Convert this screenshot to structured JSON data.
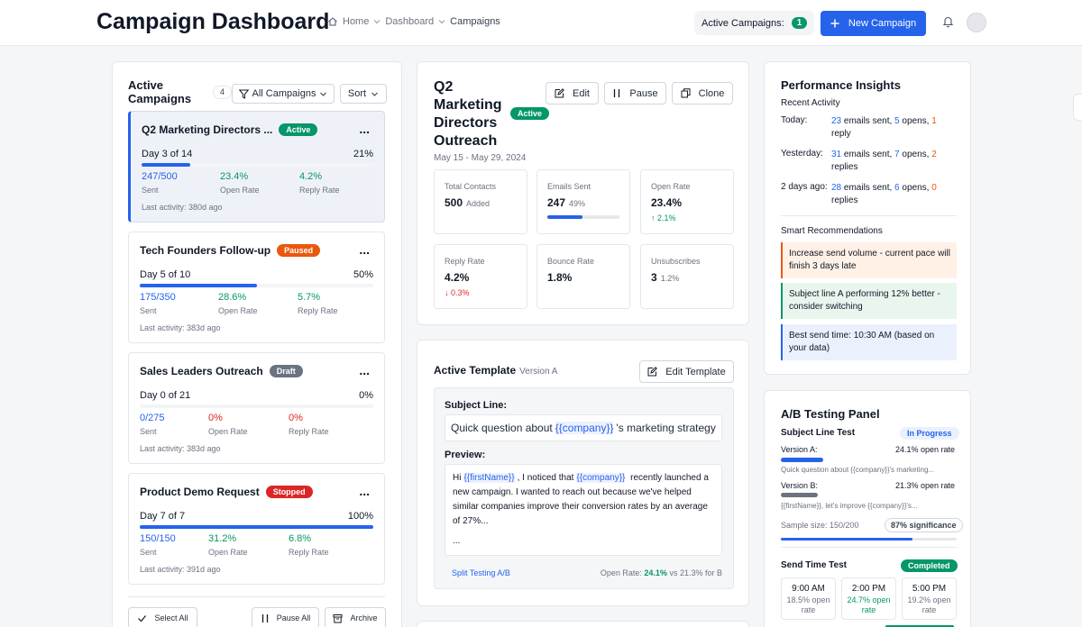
{
  "header": {
    "title": "Campaign Dashboard",
    "breadcrumb": [
      "Home",
      "Dashboard",
      "Campaigns"
    ],
    "active_campaigns_label": "Active Campaigns:",
    "active_campaigns_count": "1",
    "new_campaign_label": "New Campaign"
  },
  "left": {
    "title": "Active Campaigns",
    "count": "4",
    "filter_label": "All Campaigns",
    "sort_label": "Sort",
    "campaigns": [
      {
        "name": "Q2 Marketing Directors ...",
        "status": "Active",
        "day": "Day 3 of 14",
        "pct": "21%",
        "progress": 0.21,
        "sent": "247/500",
        "open": "23.4%",
        "reply": "4.2%",
        "sent_label": "Sent",
        "open_label": "Open Rate",
        "reply_label": "Reply Rate",
        "last": "Last activity: 380d ago",
        "more": "..."
      },
      {
        "name": "Tech Founders Follow-up",
        "status": "Paused",
        "day": "Day 5 of 10",
        "pct": "50%",
        "progress": 0.5,
        "sent": "175/350",
        "open": "28.6%",
        "reply": "5.7%",
        "sent_label": "Sent",
        "open_label": "Open Rate",
        "reply_label": "Reply Rate",
        "last": "Last activity: 383d ago",
        "more": "..."
      },
      {
        "name": "Sales Leaders Outreach",
        "status": "Draft",
        "day": "Day 0 of 21",
        "pct": "0%",
        "progress": 0,
        "sent": "0/275",
        "open": "0%",
        "reply": "0%",
        "sent_label": "Sent",
        "open_label": "Open Rate",
        "reply_label": "Reply Rate",
        "last": "Last activity: 383d ago",
        "more": "..."
      },
      {
        "name": "Product Demo Request",
        "status": "Stopped",
        "day": "Day 7 of 7",
        "pct": "100%",
        "progress": 1,
        "sent": "150/150",
        "open": "31.2%",
        "reply": "6.8%",
        "sent_label": "Sent",
        "open_label": "Open Rate",
        "reply_label": "Reply Rate",
        "last": "Last activity: 391d ago",
        "more": "..."
      }
    ],
    "select_all": "Select All",
    "pause_all": "Pause All",
    "archive": "Archive"
  },
  "detail": {
    "title_lines": [
      "Q2",
      "Marketing",
      "Directors",
      "Outreach"
    ],
    "status": "Active",
    "dates": "May 15 - May 29, 2024",
    "edit": "Edit",
    "pause": "Pause",
    "clone": "Clone",
    "metrics": {
      "total_contacts": {
        "label": "Total Contacts",
        "value": "500",
        "sub": "Added"
      },
      "emails_sent": {
        "label": "Emails Sent",
        "value": "247",
        "sub": "49%",
        "progress": 0.49
      },
      "open_rate": {
        "label": "Open Rate",
        "value": "23.4%",
        "change": "↑ 2.1%"
      },
      "reply_rate": {
        "label": "Reply Rate",
        "value": "4.2%",
        "change": "↓ 0.3%"
      },
      "bounce_rate": {
        "label": "Bounce Rate",
        "value": "1.8%"
      },
      "unsubscribes": {
        "label": "Unsubscribes",
        "value": "3",
        "sub": "1.2%"
      }
    }
  },
  "template": {
    "title": "Active Template",
    "version": "Version A",
    "edit": "Edit Template",
    "subject_label": "Subject Line:",
    "subject_pre": "Quick question about",
    "subject_var": "{{company}}",
    "subject_post": "'s marketing strategy",
    "preview_label": "Preview:",
    "preview_hi": "Hi",
    "preview_var1": "{{firstName}}",
    "preview_mid": ", I noticed that",
    "preview_var2": "{{company}}",
    "preview_rest": "recently launched a new campaign. I wanted to reach out because we've helped similar companies improve their conversion rates by an average of 27%...",
    "preview_ellipsis": "...",
    "split": "Split Testing A/B",
    "open_label": "Open Rate:",
    "open_a": "24.1%",
    "open_b": "vs 21.3% for B"
  },
  "insights": {
    "title": "Performance Insights",
    "recent_label": "Recent Activity",
    "activity": [
      {
        "label": "Today:",
        "emails": "23",
        "emails_txt": " emails sent, ",
        "opens": "5",
        "opens_txt": " opens, ",
        "replies": "1",
        "replies_txt": " reply"
      },
      {
        "label": "Yesterday:",
        "emails": "31",
        "emails_txt": " emails sent, ",
        "opens": "7",
        "opens_txt": " opens, ",
        "replies": "2",
        "replies_txt": " replies"
      },
      {
        "label": "2 days ago:",
        "emails": "28",
        "emails_txt": " emails sent, ",
        "opens": "6",
        "opens_txt": " opens, ",
        "replies": "0",
        "replies_txt": " replies"
      }
    ],
    "reco_label": "Smart Recommendations",
    "recos": [
      "Increase send volume - current pace will finish 3 days late",
      "Subject line A performing 12% better - consider switching",
      "Best send time: 10:30 AM (based on your data)"
    ]
  },
  "ab": {
    "title": "A/B Testing Panel",
    "subject_test": "Subject Line Test",
    "subject_status": "In Progress",
    "version_a": "Version A:",
    "version_a_rate": "24.1% open rate",
    "version_a_share": 0.24,
    "version_a_preview": "Quick question about {{company}}'s marketing...",
    "version_b": "Version B:",
    "version_b_rate": "21.3% open rate",
    "version_b_share": 0.21,
    "version_b_preview": "{{firstName}}, let's improve {{company}}'s...",
    "sample": "Sample size: 150/200",
    "significance": "87% significance",
    "sample_progress": 0.75,
    "send_time_test": "Send Time Test",
    "send_time_status": "Completed",
    "times": [
      {
        "time": "9:00 AM",
        "rate": "18.5% open rate"
      },
      {
        "time": "2:00 PM",
        "rate": "24.7% open rate"
      },
      {
        "time": "5:00 PM",
        "rate": "19.2% open rate"
      }
    ]
  },
  "colors": {
    "accent": "#2563eb",
    "active": "#059669",
    "paused": "#ea580c",
    "draft": "#6b7280",
    "stopped": "#dc2626"
  }
}
